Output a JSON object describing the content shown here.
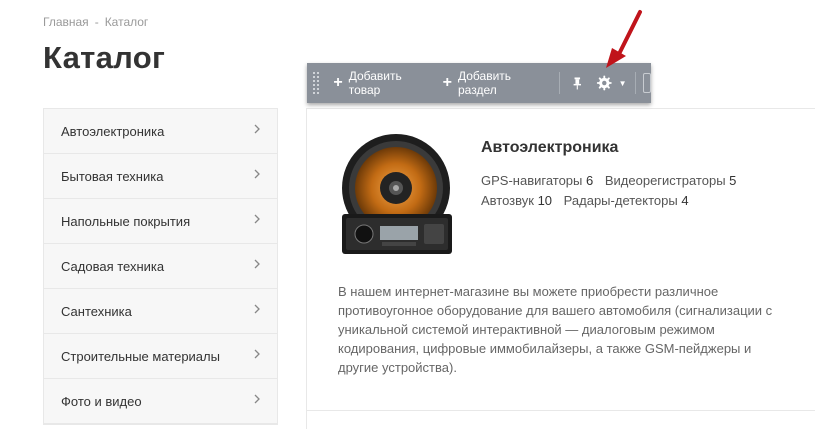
{
  "breadcrumb": {
    "home": "Главная",
    "separator": "-",
    "current": "Каталог"
  },
  "page_title": "Каталог",
  "sidebar": {
    "items": [
      {
        "label": "Автоэлектроника"
      },
      {
        "label": "Бытовая техника"
      },
      {
        "label": "Напольные покрытия"
      },
      {
        "label": "Садовая техника"
      },
      {
        "label": "Сантехника"
      },
      {
        "label": "Строительные материалы"
      },
      {
        "label": "Фото и видео"
      }
    ],
    "chevron_icon": "chevron-right-icon"
  },
  "toolbar": {
    "add_product_label": "Добавить товар",
    "add_section_label": "Добавить раздел",
    "icons": [
      "drag-handle-icon",
      "plus-icon",
      "pin-icon",
      "gear-icon",
      "caret-down-icon"
    ],
    "background": "#8a9099"
  },
  "section": {
    "title": "Автоэлектроника",
    "image_label": "car-speaker-and-radio-image",
    "subcategories": [
      {
        "name": "GPS-навигаторы",
        "count": "6"
      },
      {
        "name": "Видеорегистраторы",
        "count": "5"
      },
      {
        "name": "Автозвук",
        "count": "10"
      },
      {
        "name": "Радары-детекторы",
        "count": "4"
      }
    ],
    "description": "В нашем интернет-магазине вы можете приобрести различное противоугонное оборудование для вашего автомобиля (сигнализации с уникальной системой интерактивной — диалоговым режимом кодирования, цифровые иммобилайзеры, а также GSM-пейджеры и другие устройства)."
  },
  "annotation": {
    "arrow_color": "#c0141b"
  }
}
